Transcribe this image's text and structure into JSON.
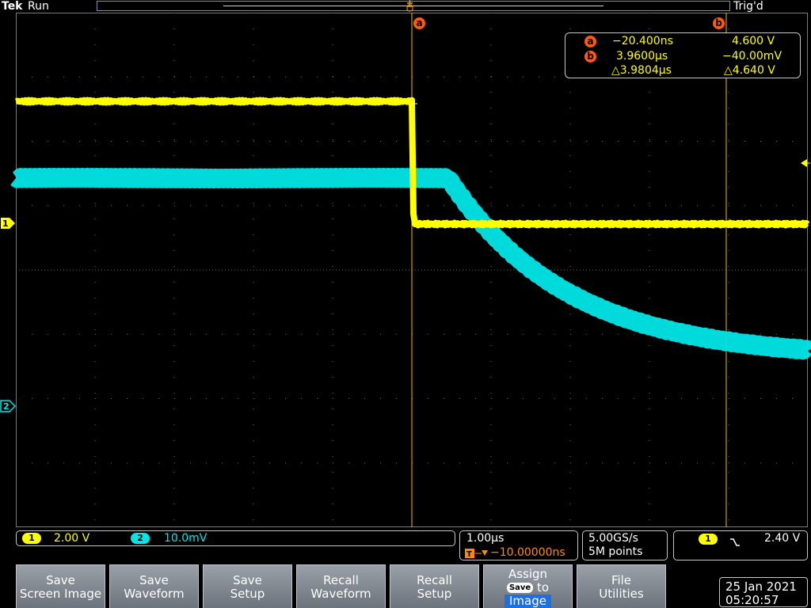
{
  "header": {
    "logo": "Tek",
    "acq_state": "Run",
    "trigger_state": "Trig'd"
  },
  "cursors": {
    "a_label": "a",
    "b_label": "b",
    "a_time": "−20.400ns",
    "a_volt": "4.600 V",
    "b_time": "3.9600µs",
    "b_volt": "−40.00mV",
    "delta_time": "△3.9804µs",
    "delta_volt": "△4.640 V"
  },
  "channels": [
    {
      "id": "1",
      "scale": "2.00 V",
      "color": "#ffff00"
    },
    {
      "id": "2",
      "scale": "10.0mV",
      "color": "#00e6e6"
    }
  ],
  "timebase": {
    "scale": "1.00µs",
    "position": "−10.00000ns",
    "sample_rate": "5.00GS/s",
    "record_length": "5M points"
  },
  "trigger": {
    "source": "1",
    "slope_icon": "falling-edge-icon",
    "level": "2.40 V"
  },
  "softkeys": [
    {
      "line1": "Save",
      "line2": "Screen Image"
    },
    {
      "line1": "Save",
      "line2": "Waveform"
    },
    {
      "line1": "Save",
      "line2": "Setup"
    },
    {
      "line1": "Recall",
      "line2": "Waveform"
    },
    {
      "line1": "Recall",
      "line2": "Setup"
    },
    {
      "line1": "Assign",
      "save_chip": "Save",
      "to": "to",
      "image": "Image"
    },
    {
      "line1": "File",
      "line2": "Utilities"
    }
  ],
  "datetime": {
    "date": "25 Jan  2021",
    "time": "05:20:57"
  },
  "colors": {
    "ch1": "#ffff00",
    "ch2": "#00e6e6",
    "cursor_badge": "#ff5a0f",
    "softkey_gray": "#8a9098",
    "accent_blue": "#1e70e0"
  }
}
